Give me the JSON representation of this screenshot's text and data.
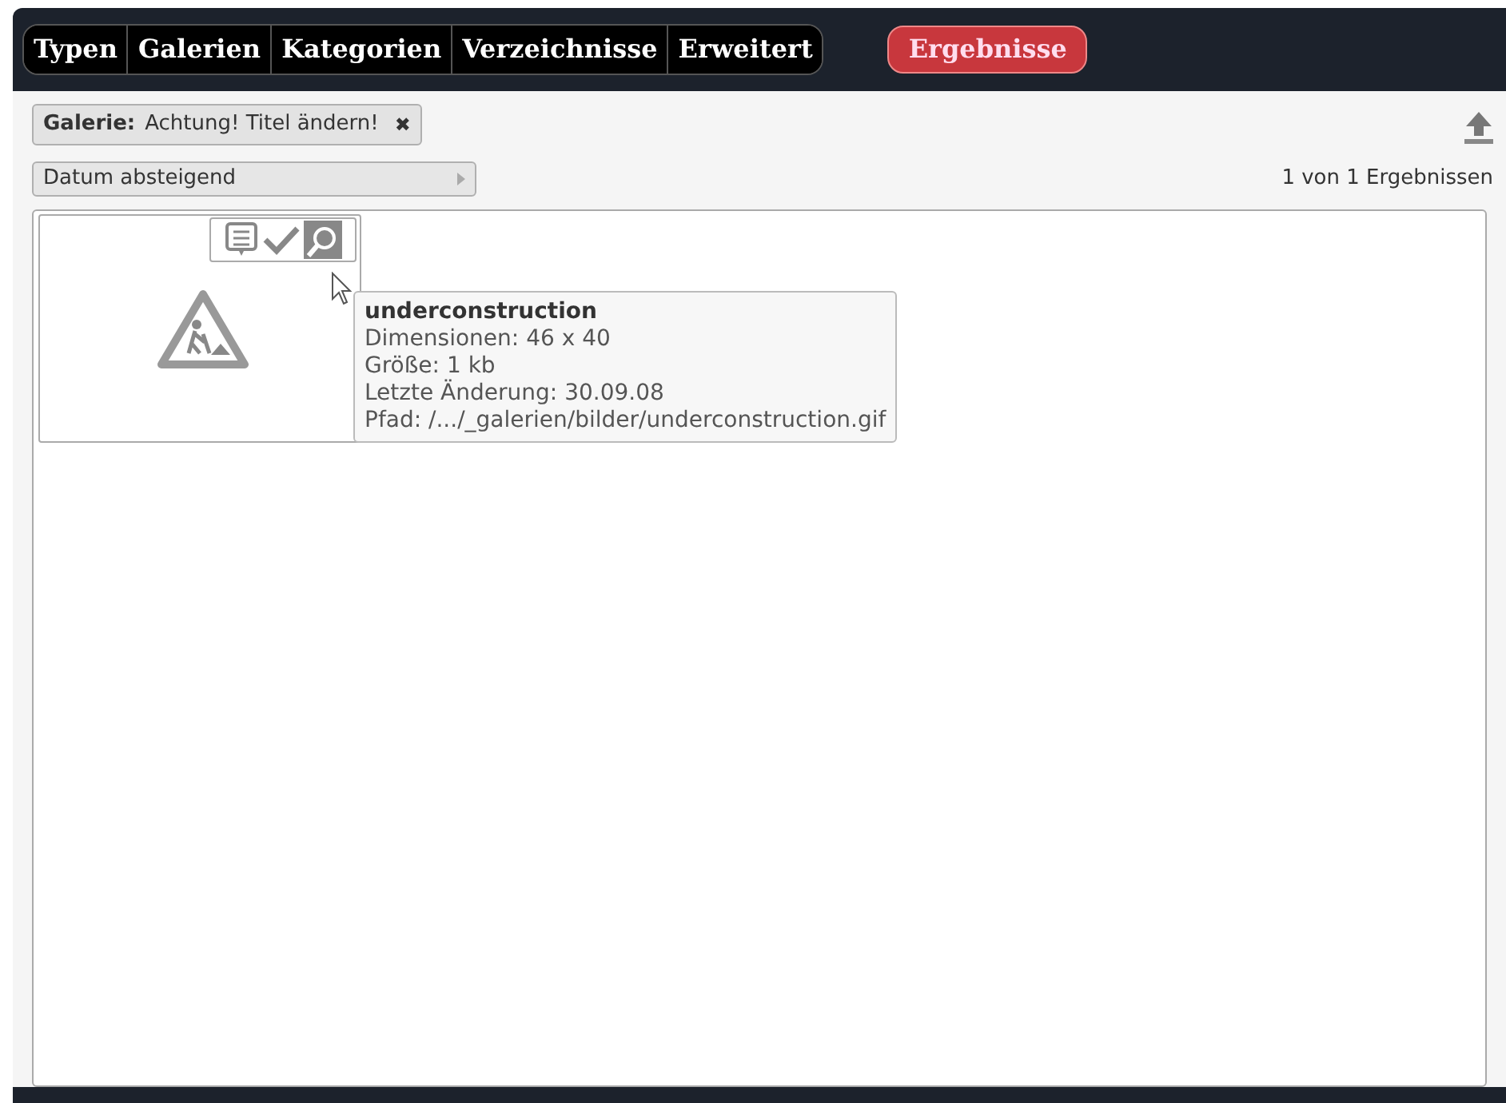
{
  "tabs": [
    {
      "label": "Typen",
      "selected": false
    },
    {
      "label": "Galerien",
      "selected": false
    },
    {
      "label": "Kategorien",
      "selected": false
    },
    {
      "label": "Verzeichnisse",
      "selected": false
    },
    {
      "label": "Erweitert",
      "selected": false
    }
  ],
  "results_tab": {
    "label": "Ergebnisse",
    "selected": true
  },
  "filter": {
    "label": "Galerie:",
    "value": "Achtung! Titel ändern!",
    "remove": "✖"
  },
  "sort": {
    "value": "Datum absteigend"
  },
  "result_count": "1 von 1 Ergebnissen",
  "tooltip": {
    "title": "underconstruction",
    "lines": [
      "Dimensionen: 46 x 40",
      "Größe: 1 kb",
      "Letzte Änderung: 30.09.08",
      "Pfad: /.../_galerien/bilder/underconstruction.gif"
    ]
  }
}
